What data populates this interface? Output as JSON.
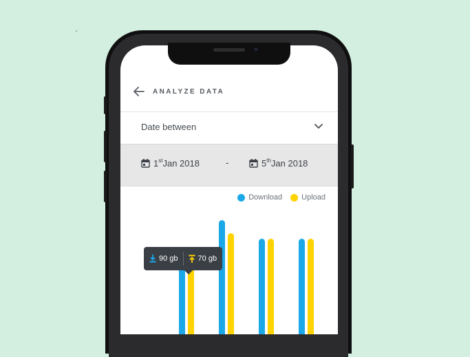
{
  "header": {
    "title": "ANALYZE DATA"
  },
  "filter": {
    "label": "Date between"
  },
  "dates": {
    "start": {
      "day": "1",
      "suffix": "st",
      "rest": " Jan 2018"
    },
    "separator": "-",
    "end": {
      "day": "5",
      "suffix": "th",
      "rest": " Jan 2018"
    }
  },
  "legend": {
    "download": "Download",
    "upload": "Upload"
  },
  "tooltip": {
    "download": "90 gb",
    "upload": "70 gb"
  },
  "colors": {
    "download": "#1ba8e8",
    "upload": "#ffd300",
    "background": "#d3efe0"
  },
  "chart_data": {
    "type": "bar",
    "categories": [
      "",
      "",
      "",
      ""
    ],
    "series": [
      {
        "name": "Download",
        "values": [
          90,
          140,
          110,
          110
        ]
      },
      {
        "name": "Upload",
        "values": [
          70,
          130,
          110,
          110
        ]
      }
    ]
  }
}
